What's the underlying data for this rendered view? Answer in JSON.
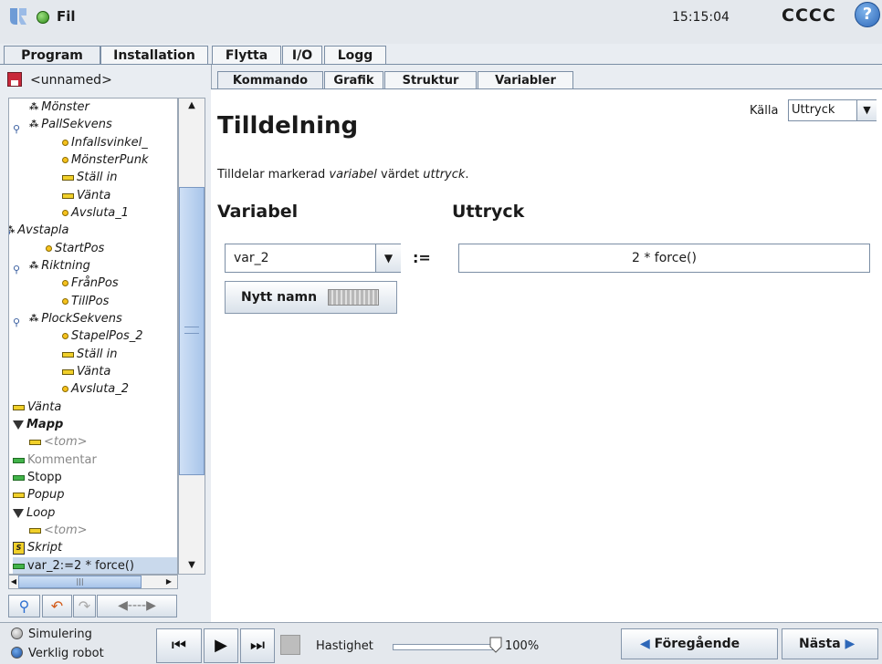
{
  "header": {
    "file_label": "Fil",
    "clock": "15:15:04",
    "robot_name": "CCCC",
    "help_symbol": "?"
  },
  "main_tabs": [
    {
      "label": "Program",
      "active": true
    },
    {
      "label": "Installation",
      "active": false
    },
    {
      "label": "Flytta",
      "active": false
    },
    {
      "label": "I/O",
      "active": false
    },
    {
      "label": "Logg",
      "active": false
    }
  ],
  "left": {
    "program_name": "<unnamed>",
    "tree": [
      {
        "label": "Mönster",
        "icon": "pallet-icon"
      },
      {
        "label": "PallSekvens",
        "icon": "pallet-icon"
      },
      {
        "label": "Infallsvinkel_",
        "icon": "waypoint-icon"
      },
      {
        "label": "MönsterPunk",
        "icon": "waypoint-icon"
      },
      {
        "label": "Ställ in",
        "icon": "command-icon"
      },
      {
        "label": "Vänta",
        "icon": "command-icon"
      },
      {
        "label": "Avsluta_1",
        "icon": "waypoint-icon"
      },
      {
        "label": "Avstapla",
        "icon": "pallet-icon"
      },
      {
        "label": "StartPos",
        "icon": "waypoint-icon"
      },
      {
        "label": "Riktning",
        "icon": "pallet-icon"
      },
      {
        "label": "FrånPos",
        "icon": "waypoint-icon"
      },
      {
        "label": "TillPos",
        "icon": "waypoint-icon"
      },
      {
        "label": "PlockSekvens",
        "icon": "pallet-icon"
      },
      {
        "label": "StapelPos_2",
        "icon": "waypoint-icon"
      },
      {
        "label": "Ställ in",
        "icon": "command-icon"
      },
      {
        "label": "Vänta",
        "icon": "command-icon"
      },
      {
        "label": "Avsluta_2",
        "icon": "waypoint-icon"
      },
      {
        "label": "Vänta",
        "icon": "command-icon"
      },
      {
        "label": "Mapp",
        "icon": "folder-icon"
      },
      {
        "label": "<tom>",
        "icon": "command-icon"
      },
      {
        "label": "Kommentar",
        "icon": "command-icon"
      },
      {
        "label": "Stopp",
        "icon": "command-icon"
      },
      {
        "label": "Popup",
        "icon": "command-icon"
      },
      {
        "label": "Loop",
        "icon": "folder-icon"
      },
      {
        "label": "<tom>",
        "icon": "command-icon"
      },
      {
        "label": "Skript",
        "icon": "script-icon"
      },
      {
        "label": "var_2:=2 * force()",
        "icon": "command-icon",
        "selected": true
      }
    ]
  },
  "content_tabs": [
    {
      "label": "Kommando",
      "active": true
    },
    {
      "label": "Grafik",
      "active": false
    },
    {
      "label": "Struktur",
      "active": false
    },
    {
      "label": "Variabler",
      "active": false
    }
  ],
  "assignment": {
    "title": "Tilldelning",
    "source_label": "Källa",
    "source_value": "Uttryck",
    "description_parts": [
      "Tilldelar markerad ",
      "variabel",
      " värdet ",
      "uttryck",
      "."
    ],
    "variable_heading": "Variabel",
    "expression_heading": "Uttryck",
    "variable_value": "var_2",
    "assign_operator": ":=",
    "expression_value": "2 * force()",
    "new_name_label": "Nytt namn"
  },
  "footer": {
    "simulation_label": "Simulering",
    "real_robot_label": "Verklig robot",
    "speed_label": "Hastighet",
    "speed_value": "100%",
    "speed_fraction": 1.0,
    "prev_label": "Föregående",
    "next_label": "Nästa"
  }
}
